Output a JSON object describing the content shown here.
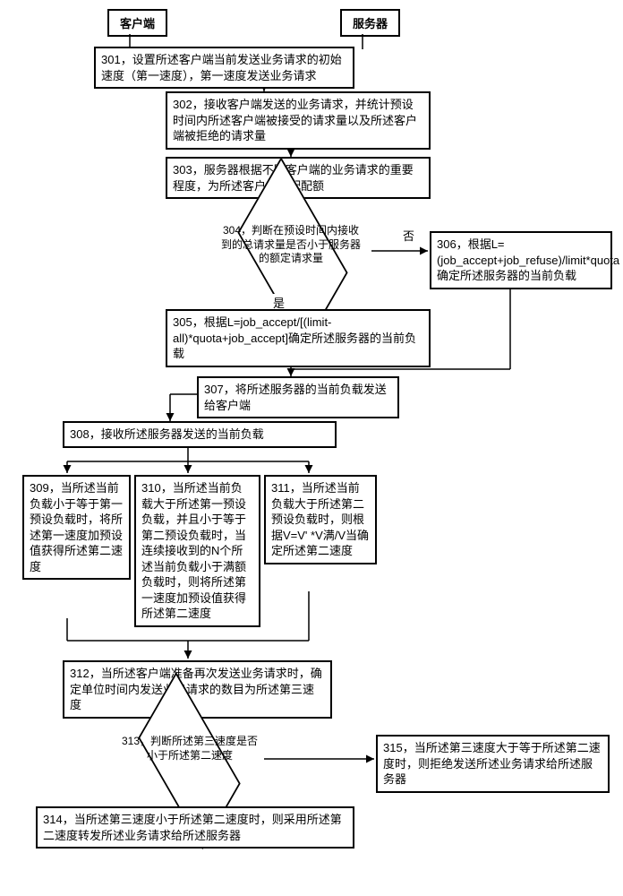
{
  "lanes": {
    "client": "客户端",
    "server": "服务器"
  },
  "steps": {
    "s301": "301，设置所述客户端当前发送业务请求的初始速度（第一速度），第一速度发送业务请求",
    "s302": "302，接收客户端发送的业务请求，并统计预设时间内所述客户端被接受的请求量以及所述客户端被拒绝的请求量",
    "s303": "303，服务器根据不同客户端的业务请求的重要程度，为所述客户端分配配额",
    "s304": "304，判断在预设时间内接收到的总请求量是否小于服务器的额定请求量",
    "s305": "305，根据L=job_accept/[(limit-all)*quota+job_accept]确定所述服务器的当前负载",
    "s306": "306，根据L=(job_accept+job_refuse)/limit*quota确定所述服务器的当前负载",
    "s307": "307，将所述服务器的当前负载发送给客户端",
    "s308": "308，接收所述服务器发送的当前负载",
    "s309": "309，当所述当前负载小于等于第一预设负载时，将所述第一速度加预设值获得所述第二速度",
    "s310": "310，当所述当前负载大于所述第一预设负载，并且小于等于第二预设负载时，当连续接收到的N个所述当前负载小于满额负载时，则将所述第一速度加预设值获得所述第二速度",
    "s311": "311，当所述当前负载大于所述第二预设负载时，则根据V=V' *V满/V当确定所述第二速度",
    "s312": "312，当所述客户端准备再次发送业务请求时，确定单位时间内发送业务请求的数目为所述第三速度",
    "s313": "313，判断所述第三速度是否小于所述第二速度",
    "s314": "314，当所述第三速度小于所述第二速度时，则采用所述第二速度转发所述业务请求给所述服务器",
    "s315": "315，当所述第三速度大于等于所述第二速度时，则拒绝发送所述业务请求给所述服务器"
  },
  "edges": {
    "yes": "是",
    "no": "否"
  }
}
